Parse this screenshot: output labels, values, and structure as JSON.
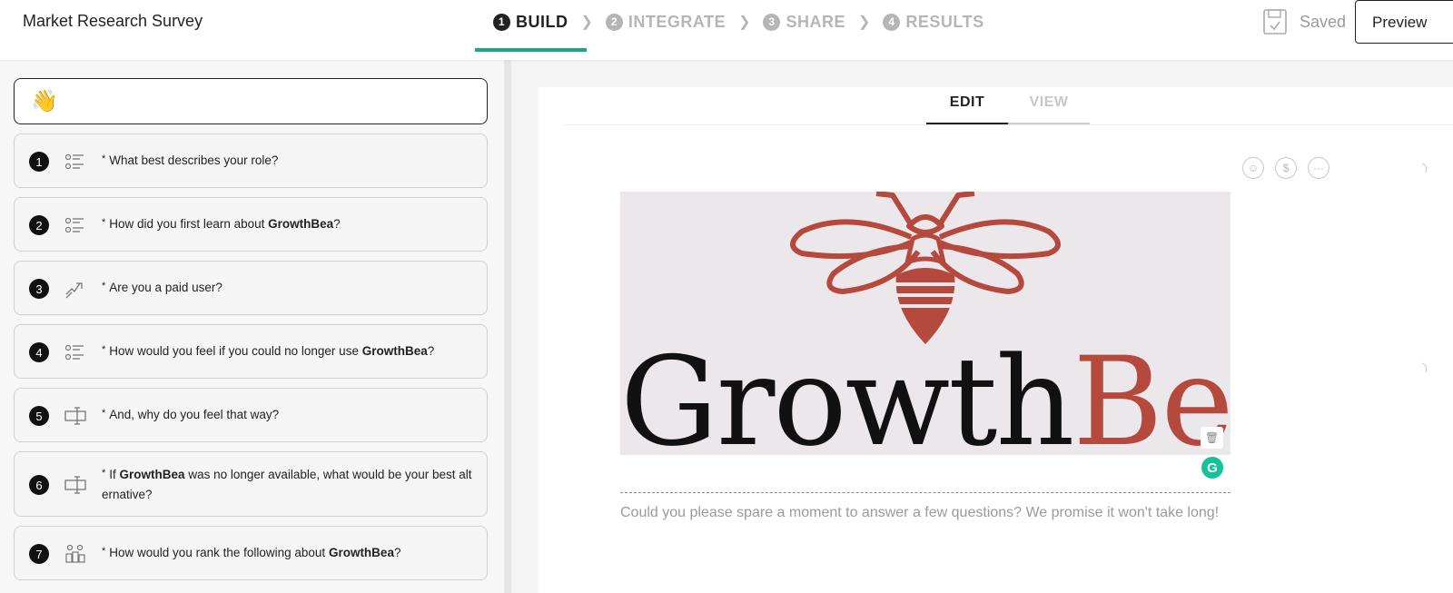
{
  "header": {
    "title": "Market Research Survey",
    "steps": [
      {
        "num": "1",
        "label": "BUILD"
      },
      {
        "num": "2",
        "label": "INTEGRATE"
      },
      {
        "num": "3",
        "label": "SHARE"
      },
      {
        "num": "4",
        "label": "RESULTS"
      }
    ],
    "saved_label": "Saved",
    "preview_label": "Preview"
  },
  "sidebar": {
    "welcome_emoji": "👋",
    "questions": [
      {
        "num": "1",
        "icon": "multiple-choice-icon",
        "text_before": "What best describes your role?",
        "bold": "",
        "text_after": ""
      },
      {
        "num": "2",
        "icon": "multiple-choice-icon",
        "text_before": "How did you first learn about ",
        "bold": "GrowthBea",
        "text_after": "?"
      },
      {
        "num": "3",
        "icon": "yes-no-icon",
        "text_before": "Are you a paid user?",
        "bold": "",
        "text_after": ""
      },
      {
        "num": "4",
        "icon": "multiple-choice-icon",
        "text_before": "How would you feel if you could no longer use ",
        "bold": "GrowthBea",
        "text_after": "?"
      },
      {
        "num": "5",
        "icon": "text-input-icon",
        "text_before": "And, why do you feel that way?",
        "bold": "",
        "text_after": ""
      },
      {
        "num": "6",
        "icon": "text-input-icon",
        "text_before": "If ",
        "bold": "GrowthBea",
        "text_after": " was no longer available, what would be your best alt ernative?"
      },
      {
        "num": "7",
        "icon": "ranking-icon",
        "text_before": "How would you rank the following about ",
        "bold": "GrowthBea",
        "text_after": "?"
      }
    ]
  },
  "editor": {
    "tab_edit": "EDIT",
    "tab_view": "VIEW",
    "tools": [
      "smiley-icon",
      "dollar-icon",
      "more-icon"
    ],
    "tool_glyphs": [
      "☺",
      "$",
      "···"
    ],
    "banner_brand_dark": "Growth",
    "banner_brand_red": "Bea",
    "brand_color": "#b5493d",
    "grammarly_letter": "G",
    "intro_text": "Could you please spare a moment to answer a few questions? We promise it won't take long!"
  },
  "colors": {
    "accent": "#1aa58c"
  }
}
